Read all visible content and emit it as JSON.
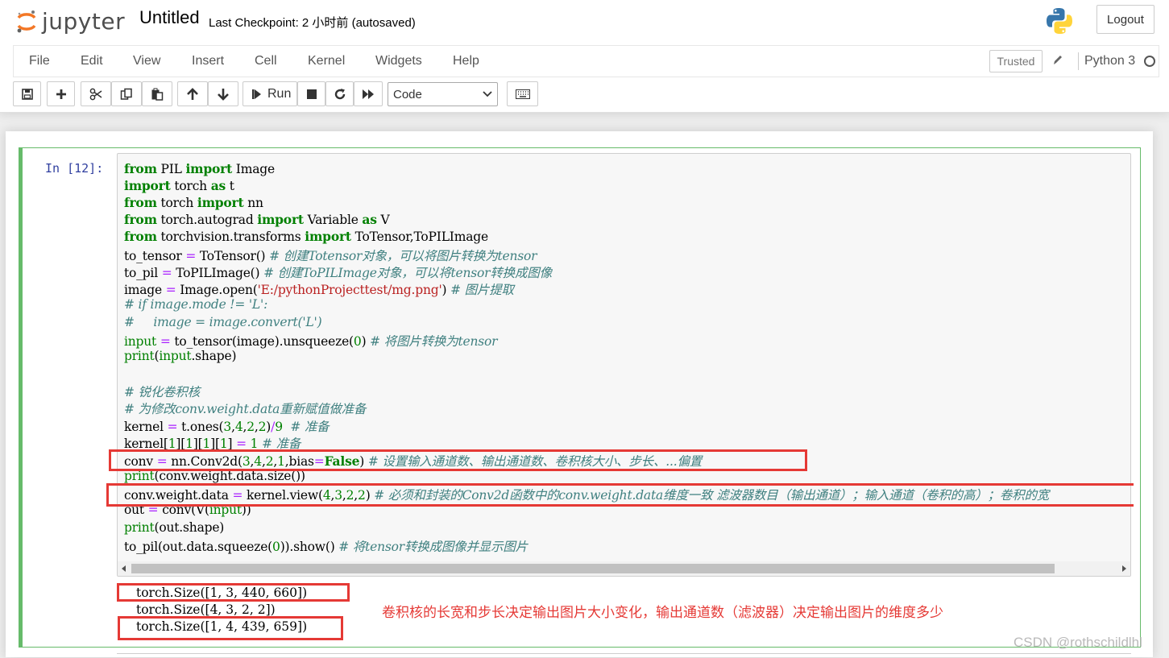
{
  "header": {
    "logo_text": "jupyter",
    "notebook_title": "Untitled",
    "checkpoint": "Last Checkpoint: 2 小时前  (autosaved)",
    "logout_label": "Logout"
  },
  "menu": {
    "items": [
      "File",
      "Edit",
      "View",
      "Insert",
      "Cell",
      "Kernel",
      "Widgets",
      "Help"
    ],
    "trusted_label": "Trusted",
    "kernel_name": "Python 3"
  },
  "toolbar": {
    "run_label": "Run",
    "cell_type": "Code"
  },
  "cell": {
    "prompt": "In  [12]:",
    "output_lines": [
      "torch.Size([1, 3, 440, 660])",
      "torch.Size([4, 3, 2, 2])",
      "torch.Size([1, 4, 439, 659])"
    ]
  },
  "annotation": "卷积核的长宽和步长决定输出图片大小变化，输出通道数（滤波器）决定输出图片的维度多少",
  "watermark": "CSDN @rothschildlhl",
  "colors": {
    "accent_green": "#66bb6a",
    "highlight_red": "#e53935",
    "prompt_blue": "#303f9f"
  }
}
